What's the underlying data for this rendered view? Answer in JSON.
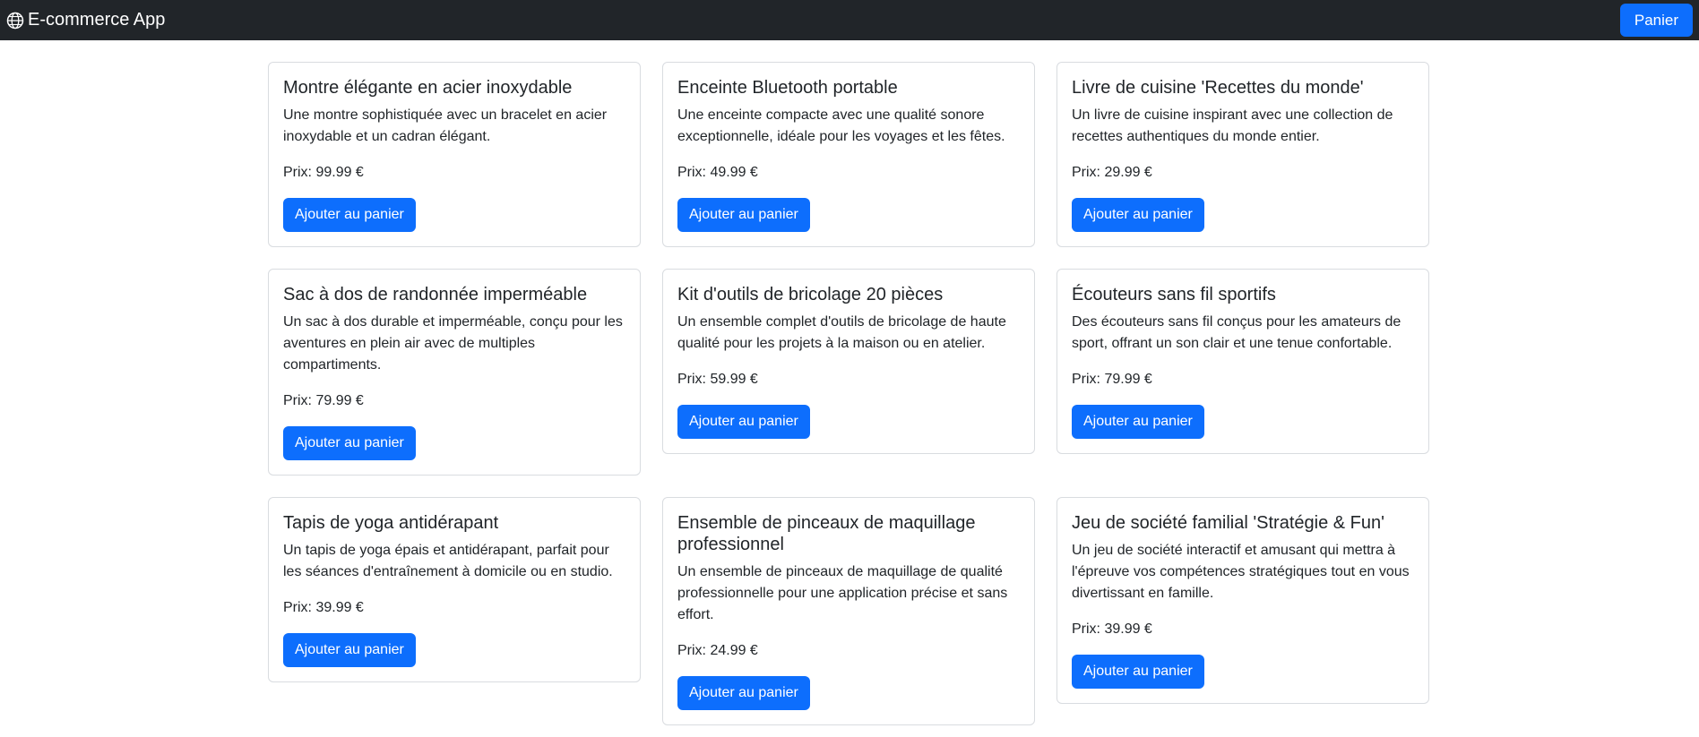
{
  "navbar": {
    "brand": "E-commerce App",
    "brand_icon": "globe-icon",
    "cart_label": "Panier"
  },
  "colors": {
    "navbar_bg": "#212529",
    "primary": "#0d6efd"
  },
  "products": [
    {
      "name": "Montre élégante en acier inoxydable",
      "description": "Une montre sophistiquée avec un bracelet en acier inoxydable et un cadran élégant.",
      "price": "Prix: 99.99 €",
      "button": "Ajouter au panier"
    },
    {
      "name": "Enceinte Bluetooth portable",
      "description": "Une enceinte compacte avec une qualité sonore exceptionnelle, idéale pour les voyages et les fêtes.",
      "price": "Prix: 49.99 €",
      "button": "Ajouter au panier"
    },
    {
      "name": "Livre de cuisine 'Recettes du monde'",
      "description": "Un livre de cuisine inspirant avec une collection de recettes authentiques du monde entier.",
      "price": "Prix: 29.99 €",
      "button": "Ajouter au panier"
    },
    {
      "name": "Sac à dos de randonnée imperméable",
      "description": "Un sac à dos durable et imperméable, conçu pour les aventures en plein air avec de multiples compartiments.",
      "price": "Prix: 79.99 €",
      "button": "Ajouter au panier"
    },
    {
      "name": "Kit d'outils de bricolage 20 pièces",
      "description": "Un ensemble complet d'outils de bricolage de haute qualité pour les projets à la maison ou en atelier.",
      "price": "Prix: 59.99 €",
      "button": "Ajouter au panier"
    },
    {
      "name": "Écouteurs sans fil sportifs",
      "description": "Des écouteurs sans fil conçus pour les amateurs de sport, offrant un son clair et une tenue confortable.",
      "price": "Prix: 79.99 €",
      "button": "Ajouter au panier"
    },
    {
      "name": "Tapis de yoga antidérapant",
      "description": "Un tapis de yoga épais et antidérapant, parfait pour les séances d'entraînement à domicile ou en studio.",
      "price": "Prix: 39.99 €",
      "button": "Ajouter au panier"
    },
    {
      "name": "Ensemble de pinceaux de maquillage professionnel",
      "description": "Un ensemble de pinceaux de maquillage de qualité professionnelle pour une application précise et sans effort.",
      "price": "Prix: 24.99 €",
      "button": "Ajouter au panier"
    },
    {
      "name": "Jeu de société familial 'Stratégie & Fun'",
      "description": "Un jeu de société interactif et amusant qui mettra à l'épreuve vos compétences stratégiques tout en vous divertissant en famille.",
      "price": "Prix: 39.99 €",
      "button": "Ajouter au panier"
    }
  ]
}
